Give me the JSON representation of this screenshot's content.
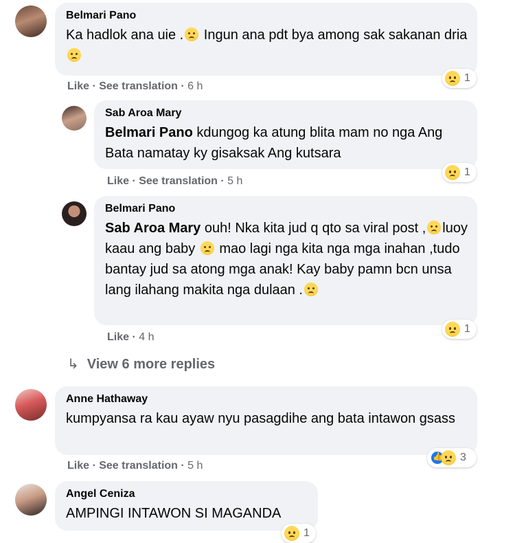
{
  "comments": [
    {
      "name": "Belmari Pano",
      "text_a": "Ka hadlok ana uie .",
      "text_b": " Ingun ana pdt bya among sak sakanan dria ",
      "like": "Like",
      "see_translation": "See translation",
      "time": "6 h",
      "reaction_count": "1"
    },
    {
      "name": "Sab Aroa Mary",
      "tag": "Belmari Pano",
      "text": " kdungog ka atung blita mam no nga Ang Bata namatay ky gisaksak Ang kutsara",
      "like": "Like",
      "see_translation": "See translation",
      "time": "5 h",
      "reaction_count": "1"
    },
    {
      "name": "Belmari Pano",
      "tag": "Sab Aroa Mary",
      "text_a": " ouh! Nka kita jud q qto sa viral post ,",
      "text_b": "luoy kaau ang baby ",
      "text_c": " mao lagi nga kita nga mga inahan ,tudo bantay jud sa atong mga anak! Kay baby pamn bcn unsa lang ilahang makita nga dulaan .",
      "like": "Like",
      "time": "4 h",
      "reaction_count": "1"
    },
    {
      "name": "Anne Hathaway",
      "text": "kumpyansa ra kau ayaw nyu pasagdihe ang bata intawon gsass",
      "like": "Like",
      "see_translation": "See translation",
      "time": "5 h",
      "reaction_count": "3"
    },
    {
      "name": "Angel Ceniza",
      "text": "AMPINGI INTAWON SI MAGANDA",
      "reaction_count": "1"
    }
  ],
  "view_more": "View 6 more replies",
  "icons": {
    "sad": "sad-reaction-icon",
    "like": "like-reaction-icon",
    "reply_arrow": "reply-arrow-icon",
    "emoji": "sad-face-emoji"
  },
  "colors": {
    "bubble": "#f0f2f5",
    "meta": "#65676b",
    "like_blue": "#1877f2"
  }
}
